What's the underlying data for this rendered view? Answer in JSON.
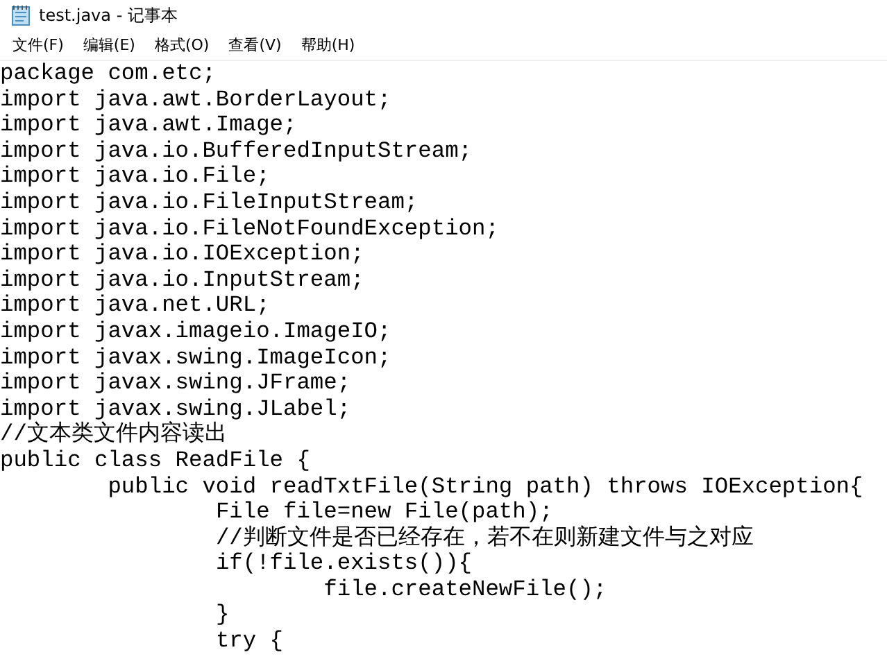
{
  "window": {
    "title": "test.java - 记事本"
  },
  "menu": [
    {
      "label": "文件(F)"
    },
    {
      "label": "编辑(E)"
    },
    {
      "label": "格式(O)"
    },
    {
      "label": "查看(V)"
    },
    {
      "label": "帮助(H)"
    }
  ],
  "editor": {
    "lines": [
      "package com.etc;",
      "import java.awt.BorderLayout;",
      "import java.awt.Image;",
      "import java.io.BufferedInputStream;",
      "import java.io.File;",
      "import java.io.FileInputStream;",
      "import java.io.FileNotFoundException;",
      "import java.io.IOException;",
      "import java.io.InputStream;",
      "import java.net.URL;",
      "import javax.imageio.ImageIO;",
      "import javax.swing.ImageIcon;",
      "import javax.swing.JFrame;",
      "import javax.swing.JLabel;",
      "//文本类文件内容读出",
      "public class ReadFile {",
      "\tpublic void readTxtFile(String path) throws IOException{",
      "\t\tFile file=new File(path);",
      "\t\t//判断文件是否已经存在，若不在则新建文件与之对应",
      "\t\tif(!file.exists()){",
      "\t\t\tfile.createNewFile();",
      "\t\t}",
      "\t\ttry {"
    ]
  }
}
